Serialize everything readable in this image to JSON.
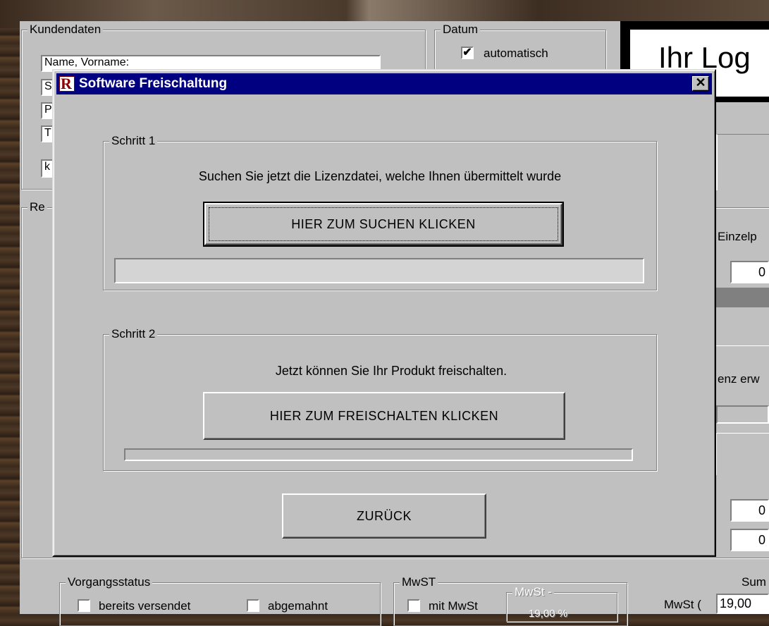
{
  "background_window": {
    "customer_group": {
      "title": "Kundendaten",
      "fields": [
        "Name, Vorname:",
        "S",
        "P",
        "T"
      ],
      "extra_field": "k"
    },
    "date_group": {
      "title": "Datum",
      "auto_checked": "✔",
      "auto_label": "automatisch"
    },
    "logo_text": "Ihr Log",
    "re_group_title": "Re",
    "right_labels": {
      "unit_price": "Einzelp",
      "unit_price_value": "0",
      "difference": "enz erw",
      "value_1": "0",
      "value_2": "0"
    },
    "status_group": {
      "title": "Vorgangsstatus",
      "sent_label": "bereits versendet",
      "reminded_label": "abgemahnt"
    },
    "vat_group": {
      "title": "MwST",
      "with_vat_label": "mit MwSt",
      "sub_title": "MwSt -",
      "sub_value": "19,00 %"
    },
    "sum": {
      "label": "Sum",
      "vat_label": "MwSt (",
      "vat_value": "19,00"
    }
  },
  "dialog": {
    "title": "Software Freischaltung",
    "close_glyph": "✕",
    "step1": {
      "title": "Schritt 1",
      "instruction": "Suchen Sie jetzt die Lizenzdatei, welche Ihnen übermittelt wurde",
      "button": "HIER ZUM SUCHEN KLICKEN",
      "progress": 0
    },
    "step2": {
      "title": "Schritt 2",
      "instruction": "Jetzt  können Sie Ihr Produkt freischalten.",
      "button": "HIER ZUM FREISCHALTEN KLICKEN",
      "progress": 0
    },
    "back_button": "ZURÜCK"
  },
  "colors": {
    "titlebar": "#000080",
    "face": "#c0c0c0"
  }
}
